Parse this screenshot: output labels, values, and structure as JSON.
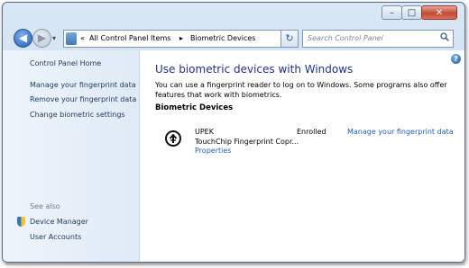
{
  "window": {
    "caption": {
      "minimize_glyph": "–",
      "maximize_glyph": "□",
      "close_glyph": "✕"
    }
  },
  "navbar": {
    "back_glyph": "◀",
    "forward_glyph": "▶",
    "breadcrumb": [
      "All Control Panel Items",
      "Biometric Devices"
    ],
    "breadcrumb_prefix": "«",
    "breadcrumb_sep": "▸",
    "dropdown_glyph": "▾",
    "refresh_glyph": "↻",
    "search_placeholder": "Search Control Panel"
  },
  "sidebar": {
    "home": "Control Panel Home",
    "tasks": [
      "Manage your fingerprint data",
      "Remove your fingerprint data",
      "Change biometric settings"
    ],
    "see_also_title": "See also",
    "see_also": [
      "Device Manager",
      "User Accounts"
    ]
  },
  "main": {
    "help_glyph": "?",
    "title": "Use biometric devices with Windows",
    "description": "You can use a fingerprint reader to log on to Windows. Some programs also offer features that work with biometrics.",
    "section_title": "Biometric Devices",
    "device": {
      "icon": "fingerprint-reader-icon",
      "vendor": "UPEK",
      "name": "TouchChip Fingerprint Copr...",
      "properties_link": "Properties",
      "status": "Enrolled",
      "manage_link": "Manage your fingerprint data"
    }
  },
  "colors": {
    "link": "#1e5fb4",
    "title": "#1e3287",
    "sidebar_link": "#1e395b"
  }
}
